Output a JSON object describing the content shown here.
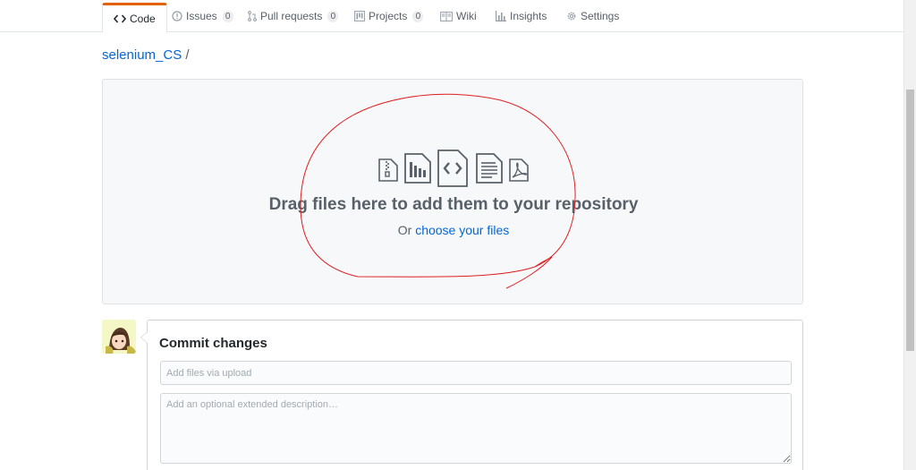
{
  "tabs": [
    {
      "label": "Code",
      "icon": "code-icon",
      "selected": true
    },
    {
      "label": "Issues",
      "icon": "issue-icon",
      "count": "0"
    },
    {
      "label": "Pull requests",
      "icon": "pull-request-icon",
      "count": "0"
    },
    {
      "label": "Projects",
      "icon": "project-icon",
      "count": "0"
    },
    {
      "label": "Wiki",
      "icon": "book-icon"
    },
    {
      "label": "Insights",
      "icon": "graph-icon"
    },
    {
      "label": "Settings",
      "icon": "gear-icon"
    }
  ],
  "breadcrumb": {
    "repo": "selenium_CS",
    "separator": "/"
  },
  "dropzone": {
    "icons": [
      "file-zip-icon",
      "file-media-icon",
      "file-code-icon",
      "file-text-icon",
      "file-pdf-icon"
    ],
    "title": "Drag files here to add them to your repository",
    "prefix": "Or",
    "link": "choose your files"
  },
  "commit": {
    "title": "Commit changes",
    "summary_placeholder": "Add files via upload",
    "summary_value": "",
    "description_placeholder": "Add an optional extended description…",
    "description_value": ""
  },
  "colors": {
    "link": "#0366d6",
    "selected_tab_accent": "#e36209",
    "annotation_circle": "#e02020"
  }
}
